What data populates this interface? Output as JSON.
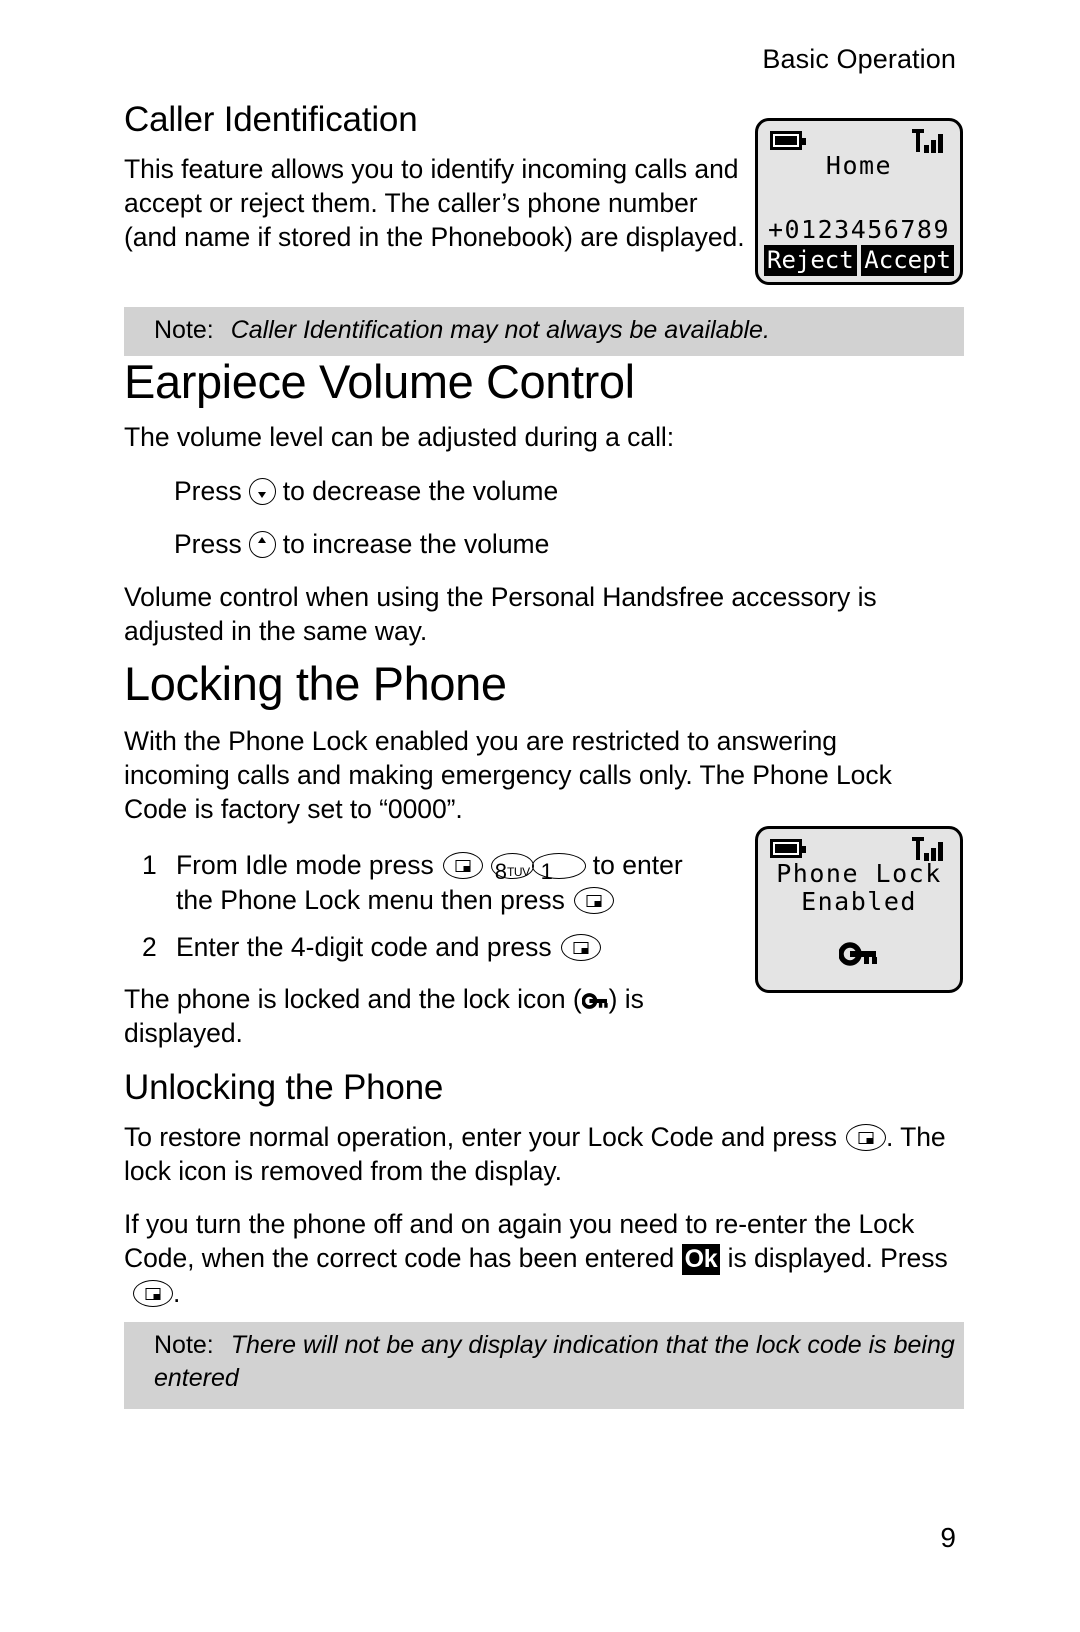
{
  "running_header": "Basic Operation",
  "page_number": "9",
  "sections": {
    "caller_id": {
      "heading": "Caller Identification",
      "body": "This feature allows you to identify incoming calls and accept or reject them. The caller’s phone number (and name if stored in the Phonebook) are displayed.",
      "note_label": "Note:",
      "note_text": "Caller Identification may not always be available."
    },
    "earpiece": {
      "heading": "Earpiece Volume Control",
      "intro": "The volume level can be adjusted during a call:",
      "decrease_before": "Press",
      "decrease_after": "to decrease the volume",
      "increase_before": "Press",
      "increase_after": "to increase the volume",
      "handsfree": "Volume control when using the Personal Handsfree accessory is adjusted in the same way."
    },
    "locking": {
      "heading": "Locking the Phone",
      "body": "With the Phone Lock enabled you are restricted to answering incoming calls and making emergency calls only. The Phone Lock Code is factory set to “0000”.",
      "step1_num": "1",
      "step1_a": "From Idle mode press",
      "step1_b": "to enter the Phone Lock  menu then press",
      "step2_num": "2",
      "step2_a": "Enter the 4-digit code and press",
      "result_a": "The phone is locked and the lock icon (",
      "result_b": ") is displayed."
    },
    "unlocking": {
      "heading": "Unlocking the Phone",
      "para1_a": "To restore normal operation, enter your Lock Code and press",
      "para1_b": ". The lock icon is removed from the display.",
      "para2_a": "If you turn the phone off and on again you need to re-enter the Lock Code, when the correct code has been entered",
      "para2_ok": "Ok",
      "para2_b": "is displayed. Press",
      "para2_c": ".",
      "note_label": "Note:",
      "note_text": "There will not be any display indication that the lock code is being entered"
    }
  },
  "keys": {
    "softkey_select": "select-softkey",
    "key_8_digit": "8",
    "key_8_letters": "TUV",
    "key_1_digit": "1",
    "volume_down": "volume-down-key",
    "volume_up": "volume-up-key"
  },
  "lcd_incoming_call": {
    "battery": "battery-full-icon",
    "signal": "signal-strength-icon",
    "caller_name": "Home",
    "caller_number": "+0123456789",
    "softkey_left": "Reject",
    "softkey_right": "Accept"
  },
  "lcd_phone_lock": {
    "battery": "battery-full-icon",
    "signal": "signal-strength-icon",
    "line1": "Phone Lock",
    "line2": "Enabled",
    "lock_icon": "key-lock-icon"
  },
  "colors": {
    "note_background": "#d2d2d2",
    "lcd_background": "#e4e4e4",
    "ink": "#000000",
    "paper": "#ffffff"
  }
}
